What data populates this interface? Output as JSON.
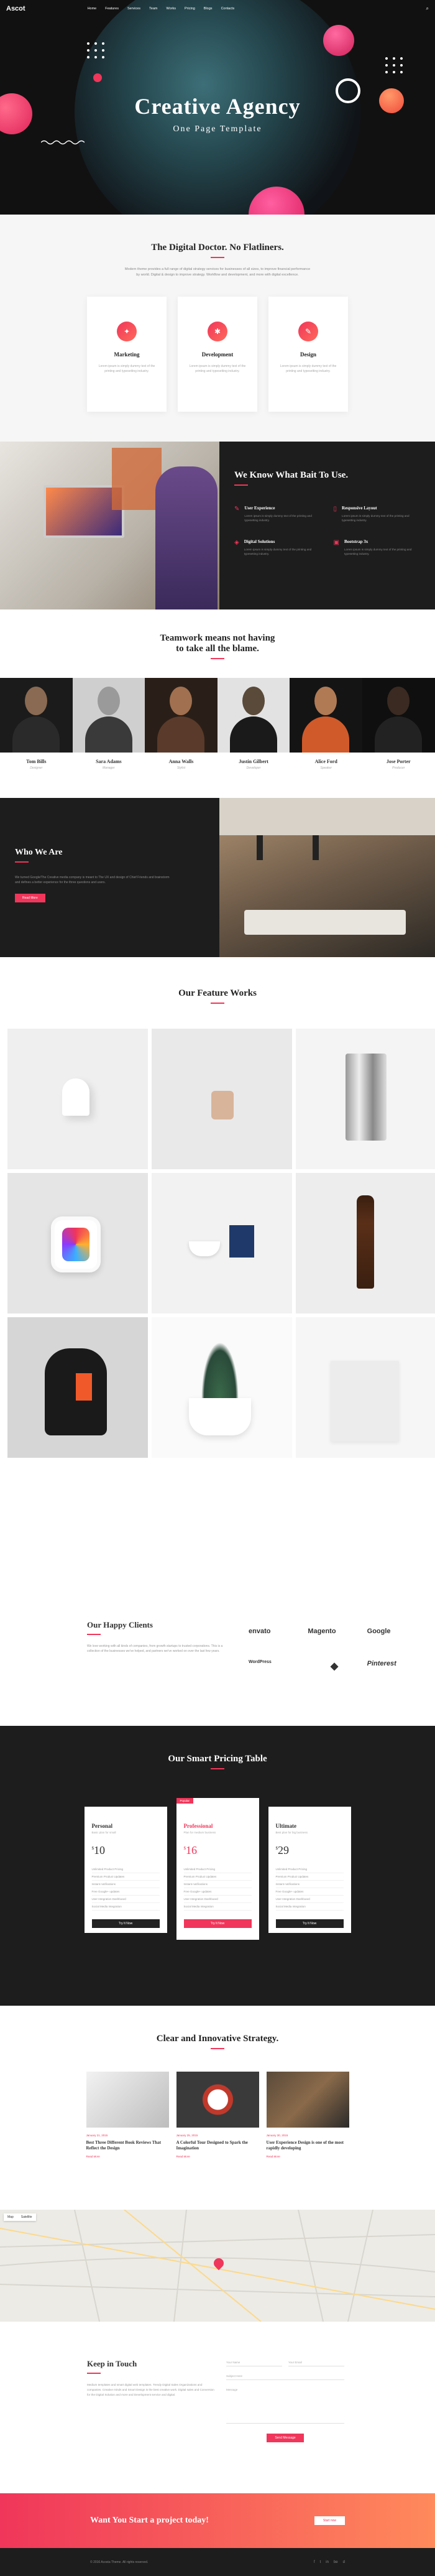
{
  "nav": {
    "logo": "Ascot",
    "items": [
      "Home",
      "Features",
      "Services",
      "Team",
      "Works",
      "Pricing",
      "Blogs",
      "Contacts"
    ]
  },
  "hero": {
    "title": "Creative Agency",
    "subtitle": "One Page Template"
  },
  "doctor": {
    "title": "The Digital Doctor. No Flatliners.",
    "lead": "Modern theme provides a full range of digital strategy services for businesses of all sizes, to improve financial performance by world. Digital & design to improve strategy. Workflow and development, and more with digital excellence.",
    "cards": [
      {
        "title": "Marketing",
        "text": "Lorem ipsum is simply dummy text of the printing and typesetting industry.",
        "icon": "megaphone-icon",
        "glyph": "✦"
      },
      {
        "title": "Development",
        "text": "Lorem ipsum is simply dummy text of the printing and typesetting industry.",
        "icon": "code-icon",
        "glyph": "✱"
      },
      {
        "title": "Design",
        "text": "Lorem ipsum is simply dummy text of the printing and typesetting industry.",
        "icon": "pen-icon",
        "glyph": "✎"
      }
    ]
  },
  "know": {
    "title": "We Know What Bait To Use.",
    "features": [
      {
        "title": "User Experience",
        "text": "Lorem ipsum is simply dummy text of the printing and typesetting industry.",
        "glyph": "✎"
      },
      {
        "title": "Responsive Layout",
        "text": "Lorem ipsum is simply dummy text of the printing and typesetting industry.",
        "glyph": "▯"
      },
      {
        "title": "Digital Solutions",
        "text": "Lorem ipsum is simply dummy text of the printing and typesetting industry.",
        "glyph": "◈"
      },
      {
        "title": "Bootstrap 3x",
        "text": "Lorem ipsum is simply dummy text of the printing and typesetting industry.",
        "glyph": "▣"
      }
    ]
  },
  "team": {
    "title_line1": "Teamwork means not having",
    "title_line2": "to take all the blame.",
    "members": [
      {
        "name": "Tom Bills",
        "role": "Designer"
      },
      {
        "name": "Sara Adams",
        "role": "Manager"
      },
      {
        "name": "Anna Walls",
        "role": "Stylist"
      },
      {
        "name": "Justin Gilbert",
        "role": "Developer"
      },
      {
        "name": "Alice Ford",
        "role": "Speaker"
      },
      {
        "name": "Jose Porter",
        "role": "Producer"
      }
    ]
  },
  "who": {
    "title": "Who We Are",
    "text": "We turned Google/The Creative media company is meant to The UX and design of Chief Friends and brainstorm and defines a better experience for the three questions and users.",
    "button": "Read More"
  },
  "works": {
    "title": "Our Feature Works"
  },
  "clients": {
    "title": "Our Happy Clients",
    "text": "We love working with all kinds of companies, from growth startups to trusted corporations. This is a collection of the businesses we've helped, and partners we've worked on over the last few years.",
    "logos": [
      "envato",
      "Magento",
      "Google",
      "WordPress",
      "",
      "Pinterest"
    ]
  },
  "pricing": {
    "title": "Our Smart Pricing Table",
    "plans": [
      {
        "name": "Personal",
        "tagline": "Basic plan for small",
        "currency": "$",
        "price": "10",
        "features": [
          "Unlimited Product Pricing",
          "Premium Product Updates",
          "Instant notifications",
          "Free Google+ updates",
          "User Integration Dashboard",
          "Social Media Integration"
        ],
        "button": "Try It Now"
      },
      {
        "name": "Professional",
        "tagline": "Plan for medium business",
        "currency": "$",
        "price": "16",
        "features": [
          "Unlimited Product Pricing",
          "Premium Product Updates",
          "Instant notifications",
          "Free Google+ updates",
          "User Integration Dashboard",
          "Social Media Integration"
        ],
        "button": "Try It Now",
        "badge": "Popular"
      },
      {
        "name": "Ultimate",
        "tagline": "Best plan for big business",
        "currency": "$",
        "price": "29",
        "features": [
          "Unlimited Product Pricing",
          "Premium Product Updates",
          "Instant notifications",
          "Free Google+ updates",
          "User Integration Dashboard",
          "Social Media Integration"
        ],
        "button": "Try It Now"
      }
    ]
  },
  "strategy": {
    "title": "Clear and Innovative Strategy.",
    "posts": [
      {
        "date": "January 21, 2015",
        "title": "Best Three Different Book Reviews That Reflect the Design",
        "more": "Read More"
      },
      {
        "date": "January 25, 2015",
        "title": "A Colorful Tour Designed to Spark the Imagination",
        "more": "Read More"
      },
      {
        "date": "January 30, 2015",
        "title": "User Experience Design is one of the most rapidly developing",
        "more": "Read More"
      }
    ]
  },
  "map": {
    "tabs": [
      "Map",
      "Satellite"
    ]
  },
  "contact": {
    "title": "Keep in Touch",
    "text": "Medium templates and smart digital web templates. Trendy Digital Sales Organizations and companies. Creative minds and Smart Design is the best creative work. Digital sales and Conversion for the Digital Solution and more and Development service and digital.",
    "fields": {
      "name": "Your Name",
      "email": "Your Email",
      "subject": "Subject Here",
      "message": "Message"
    },
    "button": "Send Message"
  },
  "cta": {
    "title": "Want You Start a project today!",
    "button": "Start now"
  },
  "footer": {
    "copyright": "© 2016 Acosta Theme. All rights reserved.",
    "social": [
      "f",
      "t",
      "in",
      "be",
      "d"
    ]
  },
  "colors": {
    "accent": "#f0365a",
    "dark": "#1d1d1d"
  }
}
